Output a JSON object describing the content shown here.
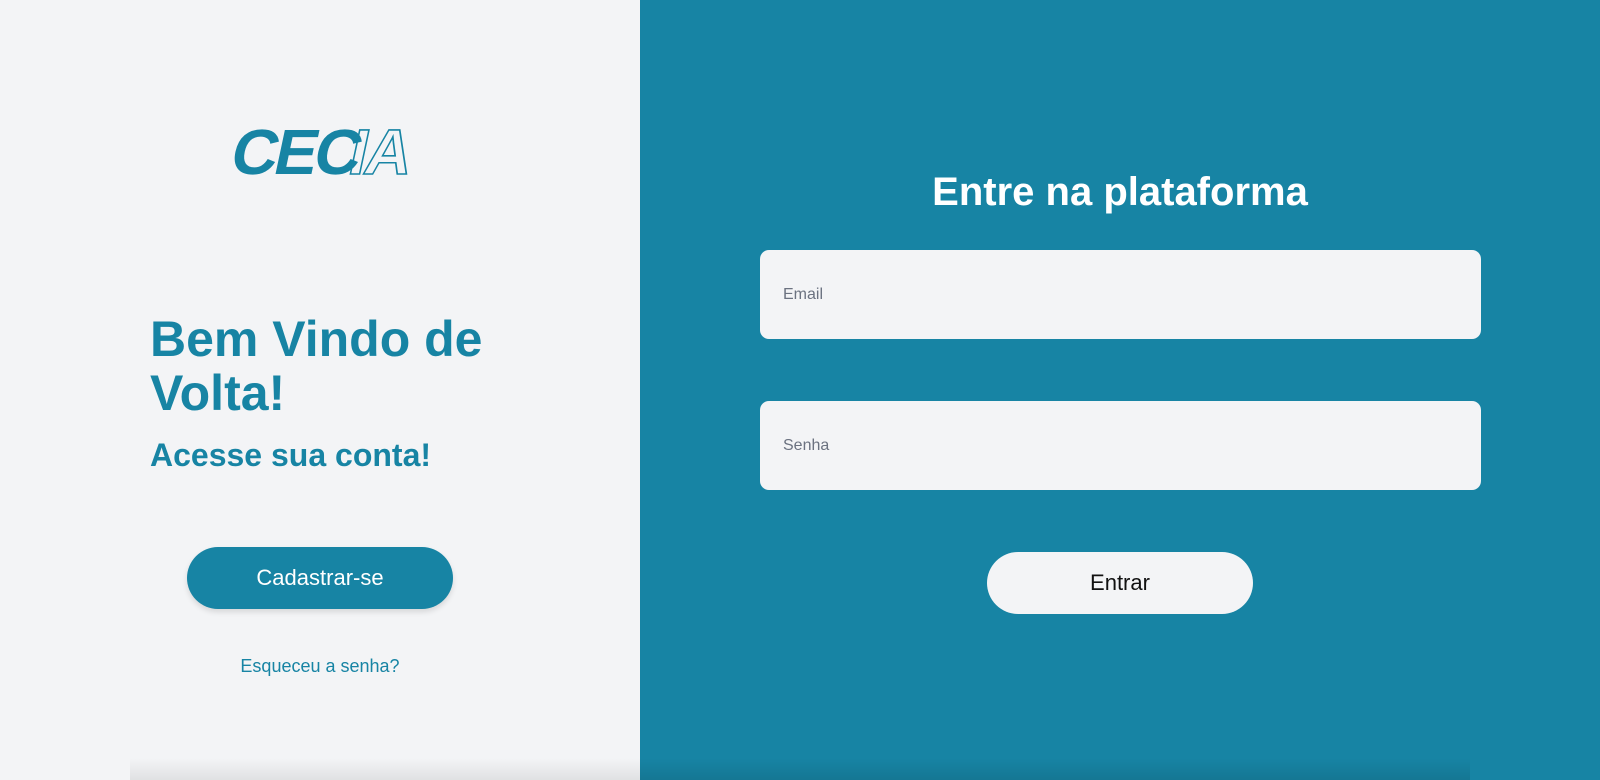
{
  "brand": {
    "logo_text": "CECIA",
    "color_primary": "#1784a4",
    "color_light": "#f3f4f6"
  },
  "welcome": {
    "title": "Bem Vindo de Volta!",
    "subtitle": "Acesse sua conta!",
    "signup_label": "Cadastrar-se",
    "forgot_password_label": "Esqueceu a senha?"
  },
  "login_form": {
    "title": "Entre na plataforma",
    "email_placeholder": "Email",
    "password_placeholder": "Senha",
    "submit_label": "Entrar"
  }
}
